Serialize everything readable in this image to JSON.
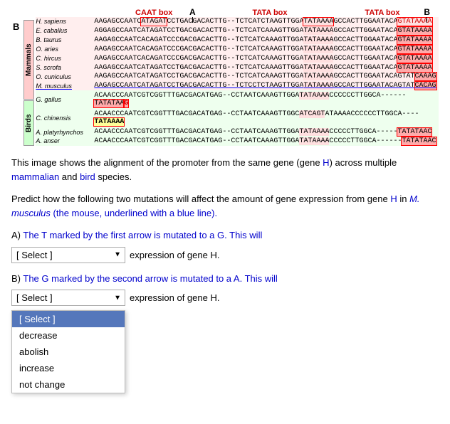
{
  "header": {
    "label_b": "B",
    "arrow_a_label": "A",
    "arrow_b_label": "B",
    "caat_box_label": "CAAT box",
    "tata_box_label": "TATA box",
    "tata_box2_label": "TATA box"
  },
  "groups": {
    "mammals_label": "Mammals",
    "birds_label": "Birds"
  },
  "species": [
    {
      "name": "H. sapiens",
      "group": "mammal",
      "underline": false,
      "seq": "AAGAGCCAATCATAGATCCTGACGACACTTG--TCTCATCTAAGTTGGATATAAAAGCCACTTGGAATACAGTATAAAA"
    },
    {
      "name": "E. caballus",
      "group": "mammal",
      "underline": false,
      "seq": "AGGAGCCAATCATAGATCCTGACGACACTTG--TCTCATCAAAGTTGGATATAAAAGCCACTTGGAATACAGTATAAAA"
    },
    {
      "name": "B. taurus",
      "group": "mammal",
      "underline": false,
      "seq": "AAGAGCCAATCACAGATCCCGACGACACTTG--TCTCATCAAAGTTGGATATAAAAGCCACTTGGAATACAGTATAAAA"
    },
    {
      "name": "O. aries",
      "group": "mammal",
      "underline": false,
      "seq": "AAGAGCCAATCACAGATCCCGACGACACTTG--TCTCATCAAAGTTGGATATAAAAGCCACTTGGAATACAGTATAAAA"
    },
    {
      "name": "C. hircus",
      "group": "mammal",
      "underline": false,
      "seq": "AAGAGCCAATCACAGATCCCGACGACACTTG--TCTCATCAAAGTTGGATATAAAAGCCACTTGGAATACAGTATAAAA"
    },
    {
      "name": "S. scrofa",
      "group": "mammal",
      "underline": false,
      "seq": "AAGAGCCAATCATAGATCCTGACGACACTTG--TCTCATCAAAGTTGGATATAAAAGCCACTTGGAATACAGTATAAAA"
    },
    {
      "name": "O. cuniculus",
      "group": "mammal",
      "underline": false,
      "seq": "AAGAGCCAATCATAGATCCTGACGACACTTG--TCTCATCAAAGTTGGATATAAAAGCCACTTGGAATACAGTATCAAAG"
    },
    {
      "name": "M. musculus",
      "group": "mammal",
      "underline": true,
      "seq": "AAGAGCCAATCATAGATCCTGACGACACTTG--TCTCCTCTAAGTTGGATATAAAAGCCACTTGGAATACAGTATCACAG"
    },
    {
      "name": "G. gallus",
      "group": "bird",
      "underline": false,
      "seq": "ACAACCCAATCGTCGGTTTGACGACATGAG--CCTAATCAAAGTTGGATATAAAACCCCCCTTGGCA------TATATAA"
    },
    {
      "name": "C. chinensis",
      "group": "bird",
      "underline": false,
      "seq": "ACAACCCAATCGTCGGTTTGACGACATGAG--CCTAATCAAAGTTGGCATCAGTATAAAACCCCCCTTGGCA----TATAAAA"
    },
    {
      "name": "A. platyrhynchos",
      "group": "bird",
      "underline": false,
      "seq": "ACAACCCAATCGTCGGTTTGACGACATGAG--CCTAATCAAAGTTGGATATAAAACCCCCTTGGCA-----TATATAAC"
    },
    {
      "name": "A. anser",
      "group": "bird",
      "underline": false,
      "seq": "ACAACCCAATCGTCGGTTTGACGACATGAG--CCTAATCAAAGTTGGATATAAAACCCCCTTGGCA------TATATAAC"
    }
  ],
  "description": {
    "line1": "This image shows the alignment of the promoter from the same gene (gene H) across",
    "line2": "multiple mammalian and bird species.",
    "blue_words": [
      "H",
      "mammalian",
      "bird"
    ]
  },
  "predict_text": "Predict how the following two mutations will affect the amount of gene expression from gene H in M. musculus (the mouse, underlined with a blue line).",
  "question_a": {
    "label": "A)",
    "text_before": "The T marked by the first arrow is mutated to a G. This will",
    "select_placeholder": "[ Select ]",
    "text_after": "expression of gene H.",
    "options": [
      "[ Select ]",
      "decrease",
      "abolish",
      "increase",
      "not change"
    ],
    "selected": null
  },
  "question_b": {
    "label": "B)",
    "text_before": "The G marked by the second arrow is mutated to a A. This will",
    "select_placeholder": "[ Select ]",
    "text_after": "expression of gene H.",
    "options": [
      "[ Select ]",
      "decrease",
      "abolish",
      "increase",
      "not change"
    ],
    "selected": "[ Select ]",
    "dropdown_open": true,
    "dropdown_items": [
      "[ Select ]",
      "decrease",
      "abolish",
      "increase",
      "not change"
    ]
  },
  "colors": {
    "mammal_bg": "#ffeeee",
    "bird_bg": "#eeffee",
    "red_text": "#cc0000",
    "blue_text": "#0000cc",
    "highlight_red": "#ffcccc",
    "highlight_yellow": "#ffffcc"
  }
}
